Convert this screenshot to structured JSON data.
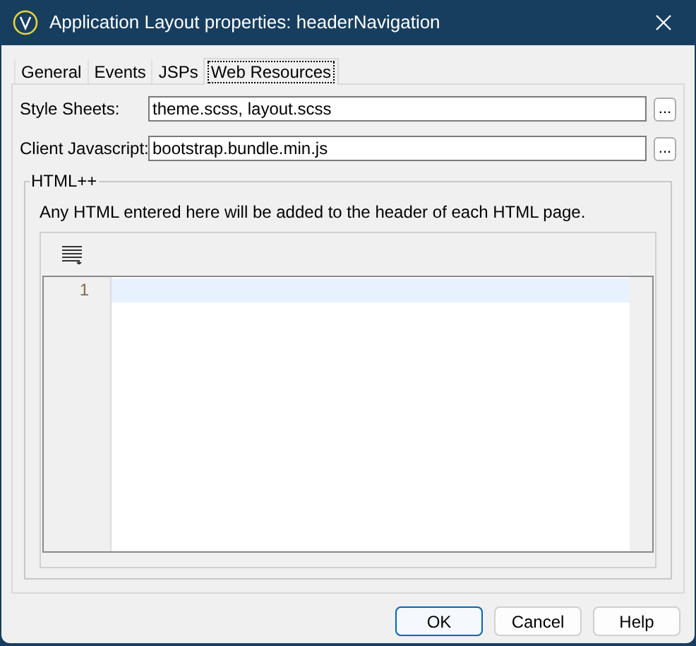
{
  "window": {
    "title": "Application Layout properties: headerNavigation"
  },
  "tabs": [
    {
      "label": "General",
      "selected": false
    },
    {
      "label": "Events",
      "selected": false
    },
    {
      "label": "JSPs",
      "selected": false
    },
    {
      "label": "Web Resources",
      "selected": true
    }
  ],
  "fields": [
    {
      "label": "Style Sheets:",
      "value": "theme.scss, layout.scss",
      "button": "..."
    },
    {
      "label": "Client Javascript:",
      "value": "bootstrap.bundle.min.js",
      "button": "..."
    }
  ],
  "group": {
    "title": "HTML++",
    "hint": "Any HTML entered here will be added to the header of each HTML page.",
    "editor": {
      "line_numbers": [
        "1"
      ]
    }
  },
  "buttons": [
    {
      "label": "OK",
      "default": true
    },
    {
      "label": "Cancel",
      "default": false
    },
    {
      "label": "Help",
      "default": false
    }
  ]
}
